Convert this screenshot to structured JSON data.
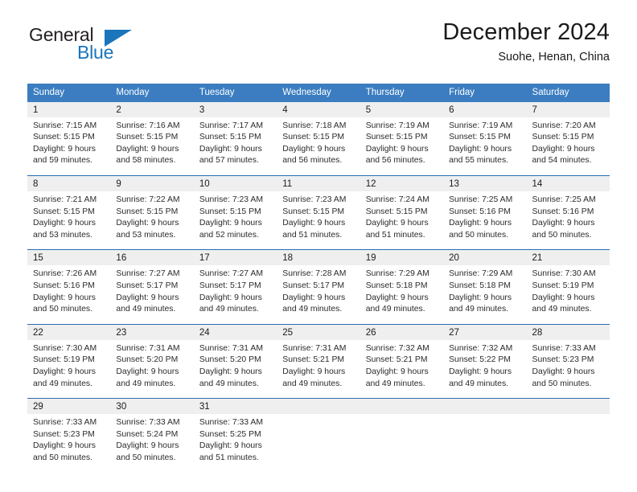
{
  "logo": {
    "word_top": "General",
    "word_bottom": "Blue",
    "triangle_color": "#1b75bb"
  },
  "header": {
    "title": "December 2024",
    "subtitle": "Suohe, Henan, China"
  },
  "theme": {
    "header_blue": "#3b7dc0",
    "row_divider": "#2a6cb2",
    "daynum_band": "#efefef",
    "text": "#1a1a1a"
  },
  "calendar": {
    "weekday_headers": [
      "Sunday",
      "Monday",
      "Tuesday",
      "Wednesday",
      "Thursday",
      "Friday",
      "Saturday"
    ],
    "weeks": [
      [
        {
          "day": "1",
          "sunrise": "Sunrise: 7:15 AM",
          "sunset": "Sunset: 5:15 PM",
          "daylight_1": "Daylight: 9 hours",
          "daylight_2": "and 59 minutes."
        },
        {
          "day": "2",
          "sunrise": "Sunrise: 7:16 AM",
          "sunset": "Sunset: 5:15 PM",
          "daylight_1": "Daylight: 9 hours",
          "daylight_2": "and 58 minutes."
        },
        {
          "day": "3",
          "sunrise": "Sunrise: 7:17 AM",
          "sunset": "Sunset: 5:15 PM",
          "daylight_1": "Daylight: 9 hours",
          "daylight_2": "and 57 minutes."
        },
        {
          "day": "4",
          "sunrise": "Sunrise: 7:18 AM",
          "sunset": "Sunset: 5:15 PM",
          "daylight_1": "Daylight: 9 hours",
          "daylight_2": "and 56 minutes."
        },
        {
          "day": "5",
          "sunrise": "Sunrise: 7:19 AM",
          "sunset": "Sunset: 5:15 PM",
          "daylight_1": "Daylight: 9 hours",
          "daylight_2": "and 56 minutes."
        },
        {
          "day": "6",
          "sunrise": "Sunrise: 7:19 AM",
          "sunset": "Sunset: 5:15 PM",
          "daylight_1": "Daylight: 9 hours",
          "daylight_2": "and 55 minutes."
        },
        {
          "day": "7",
          "sunrise": "Sunrise: 7:20 AM",
          "sunset": "Sunset: 5:15 PM",
          "daylight_1": "Daylight: 9 hours",
          "daylight_2": "and 54 minutes."
        }
      ],
      [
        {
          "day": "8",
          "sunrise": "Sunrise: 7:21 AM",
          "sunset": "Sunset: 5:15 PM",
          "daylight_1": "Daylight: 9 hours",
          "daylight_2": "and 53 minutes."
        },
        {
          "day": "9",
          "sunrise": "Sunrise: 7:22 AM",
          "sunset": "Sunset: 5:15 PM",
          "daylight_1": "Daylight: 9 hours",
          "daylight_2": "and 53 minutes."
        },
        {
          "day": "10",
          "sunrise": "Sunrise: 7:23 AM",
          "sunset": "Sunset: 5:15 PM",
          "daylight_1": "Daylight: 9 hours",
          "daylight_2": "and 52 minutes."
        },
        {
          "day": "11",
          "sunrise": "Sunrise: 7:23 AM",
          "sunset": "Sunset: 5:15 PM",
          "daylight_1": "Daylight: 9 hours",
          "daylight_2": "and 51 minutes."
        },
        {
          "day": "12",
          "sunrise": "Sunrise: 7:24 AM",
          "sunset": "Sunset: 5:15 PM",
          "daylight_1": "Daylight: 9 hours",
          "daylight_2": "and 51 minutes."
        },
        {
          "day": "13",
          "sunrise": "Sunrise: 7:25 AM",
          "sunset": "Sunset: 5:16 PM",
          "daylight_1": "Daylight: 9 hours",
          "daylight_2": "and 50 minutes."
        },
        {
          "day": "14",
          "sunrise": "Sunrise: 7:25 AM",
          "sunset": "Sunset: 5:16 PM",
          "daylight_1": "Daylight: 9 hours",
          "daylight_2": "and 50 minutes."
        }
      ],
      [
        {
          "day": "15",
          "sunrise": "Sunrise: 7:26 AM",
          "sunset": "Sunset: 5:16 PM",
          "daylight_1": "Daylight: 9 hours",
          "daylight_2": "and 50 minutes."
        },
        {
          "day": "16",
          "sunrise": "Sunrise: 7:27 AM",
          "sunset": "Sunset: 5:17 PM",
          "daylight_1": "Daylight: 9 hours",
          "daylight_2": "and 49 minutes."
        },
        {
          "day": "17",
          "sunrise": "Sunrise: 7:27 AM",
          "sunset": "Sunset: 5:17 PM",
          "daylight_1": "Daylight: 9 hours",
          "daylight_2": "and 49 minutes."
        },
        {
          "day": "18",
          "sunrise": "Sunrise: 7:28 AM",
          "sunset": "Sunset: 5:17 PM",
          "daylight_1": "Daylight: 9 hours",
          "daylight_2": "and 49 minutes."
        },
        {
          "day": "19",
          "sunrise": "Sunrise: 7:29 AM",
          "sunset": "Sunset: 5:18 PM",
          "daylight_1": "Daylight: 9 hours",
          "daylight_2": "and 49 minutes."
        },
        {
          "day": "20",
          "sunrise": "Sunrise: 7:29 AM",
          "sunset": "Sunset: 5:18 PM",
          "daylight_1": "Daylight: 9 hours",
          "daylight_2": "and 49 minutes."
        },
        {
          "day": "21",
          "sunrise": "Sunrise: 7:30 AM",
          "sunset": "Sunset: 5:19 PM",
          "daylight_1": "Daylight: 9 hours",
          "daylight_2": "and 49 minutes."
        }
      ],
      [
        {
          "day": "22",
          "sunrise": "Sunrise: 7:30 AM",
          "sunset": "Sunset: 5:19 PM",
          "daylight_1": "Daylight: 9 hours",
          "daylight_2": "and 49 minutes."
        },
        {
          "day": "23",
          "sunrise": "Sunrise: 7:31 AM",
          "sunset": "Sunset: 5:20 PM",
          "daylight_1": "Daylight: 9 hours",
          "daylight_2": "and 49 minutes."
        },
        {
          "day": "24",
          "sunrise": "Sunrise: 7:31 AM",
          "sunset": "Sunset: 5:20 PM",
          "daylight_1": "Daylight: 9 hours",
          "daylight_2": "and 49 minutes."
        },
        {
          "day": "25",
          "sunrise": "Sunrise: 7:31 AM",
          "sunset": "Sunset: 5:21 PM",
          "daylight_1": "Daylight: 9 hours",
          "daylight_2": "and 49 minutes."
        },
        {
          "day": "26",
          "sunrise": "Sunrise: 7:32 AM",
          "sunset": "Sunset: 5:21 PM",
          "daylight_1": "Daylight: 9 hours",
          "daylight_2": "and 49 minutes."
        },
        {
          "day": "27",
          "sunrise": "Sunrise: 7:32 AM",
          "sunset": "Sunset: 5:22 PM",
          "daylight_1": "Daylight: 9 hours",
          "daylight_2": "and 49 minutes."
        },
        {
          "day": "28",
          "sunrise": "Sunrise: 7:33 AM",
          "sunset": "Sunset: 5:23 PM",
          "daylight_1": "Daylight: 9 hours",
          "daylight_2": "and 50 minutes."
        }
      ],
      [
        {
          "day": "29",
          "sunrise": "Sunrise: 7:33 AM",
          "sunset": "Sunset: 5:23 PM",
          "daylight_1": "Daylight: 9 hours",
          "daylight_2": "and 50 minutes."
        },
        {
          "day": "30",
          "sunrise": "Sunrise: 7:33 AM",
          "sunset": "Sunset: 5:24 PM",
          "daylight_1": "Daylight: 9 hours",
          "daylight_2": "and 50 minutes."
        },
        {
          "day": "31",
          "sunrise": "Sunrise: 7:33 AM",
          "sunset": "Sunset: 5:25 PM",
          "daylight_1": "Daylight: 9 hours",
          "daylight_2": "and 51 minutes."
        },
        {
          "day": "",
          "sunrise": "",
          "sunset": "",
          "daylight_1": "",
          "daylight_2": ""
        },
        {
          "day": "",
          "sunrise": "",
          "sunset": "",
          "daylight_1": "",
          "daylight_2": ""
        },
        {
          "day": "",
          "sunrise": "",
          "sunset": "",
          "daylight_1": "",
          "daylight_2": ""
        },
        {
          "day": "",
          "sunrise": "",
          "sunset": "",
          "daylight_1": "",
          "daylight_2": ""
        }
      ]
    ]
  }
}
